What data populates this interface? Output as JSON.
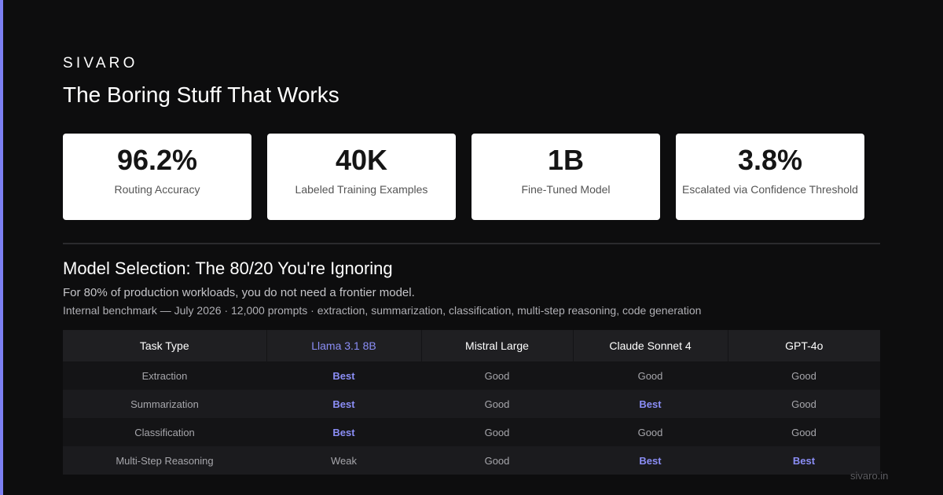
{
  "brand": "SIVARO",
  "headline": "The Boring Stuff That Works",
  "stats": [
    {
      "value": "96.2%",
      "label": "Routing Accuracy"
    },
    {
      "value": "40K",
      "label": "Labeled Training Examples"
    },
    {
      "value": "1B",
      "label": "Fine-Tuned Model"
    },
    {
      "value": "3.8%",
      "label": "Escalated via Confidence Threshold"
    }
  ],
  "section": {
    "title": "Model Selection: The 80/20 You're Ignoring",
    "subtitle": "For 80% of production workloads, you do not need a frontier model.",
    "note": "Internal benchmark — July 2026 · 12,000 prompts · extraction, summarization, classification, multi-step reasoning, code generation"
  },
  "table": {
    "headers": [
      "Task Type",
      "Llama 3.1 8B",
      "Mistral Large",
      "Claude Sonnet 4",
      "GPT-4o"
    ],
    "rows": [
      [
        "Extraction",
        "Best",
        "Good",
        "Good",
        "Good"
      ],
      [
        "Summarization",
        "Best",
        "Good",
        "Best",
        "Good"
      ],
      [
        "Classification",
        "Best",
        "Good",
        "Good",
        "Good"
      ],
      [
        "Multi-Step Reasoning",
        "Weak",
        "Good",
        "Best",
        "Best"
      ]
    ]
  },
  "footer": {
    "url": "sivaro.in"
  },
  "colors": {
    "accent": "#7c7ff2",
    "best": "#8b8ef6",
    "background": "#0d0d0e",
    "card": "#ffffff"
  }
}
